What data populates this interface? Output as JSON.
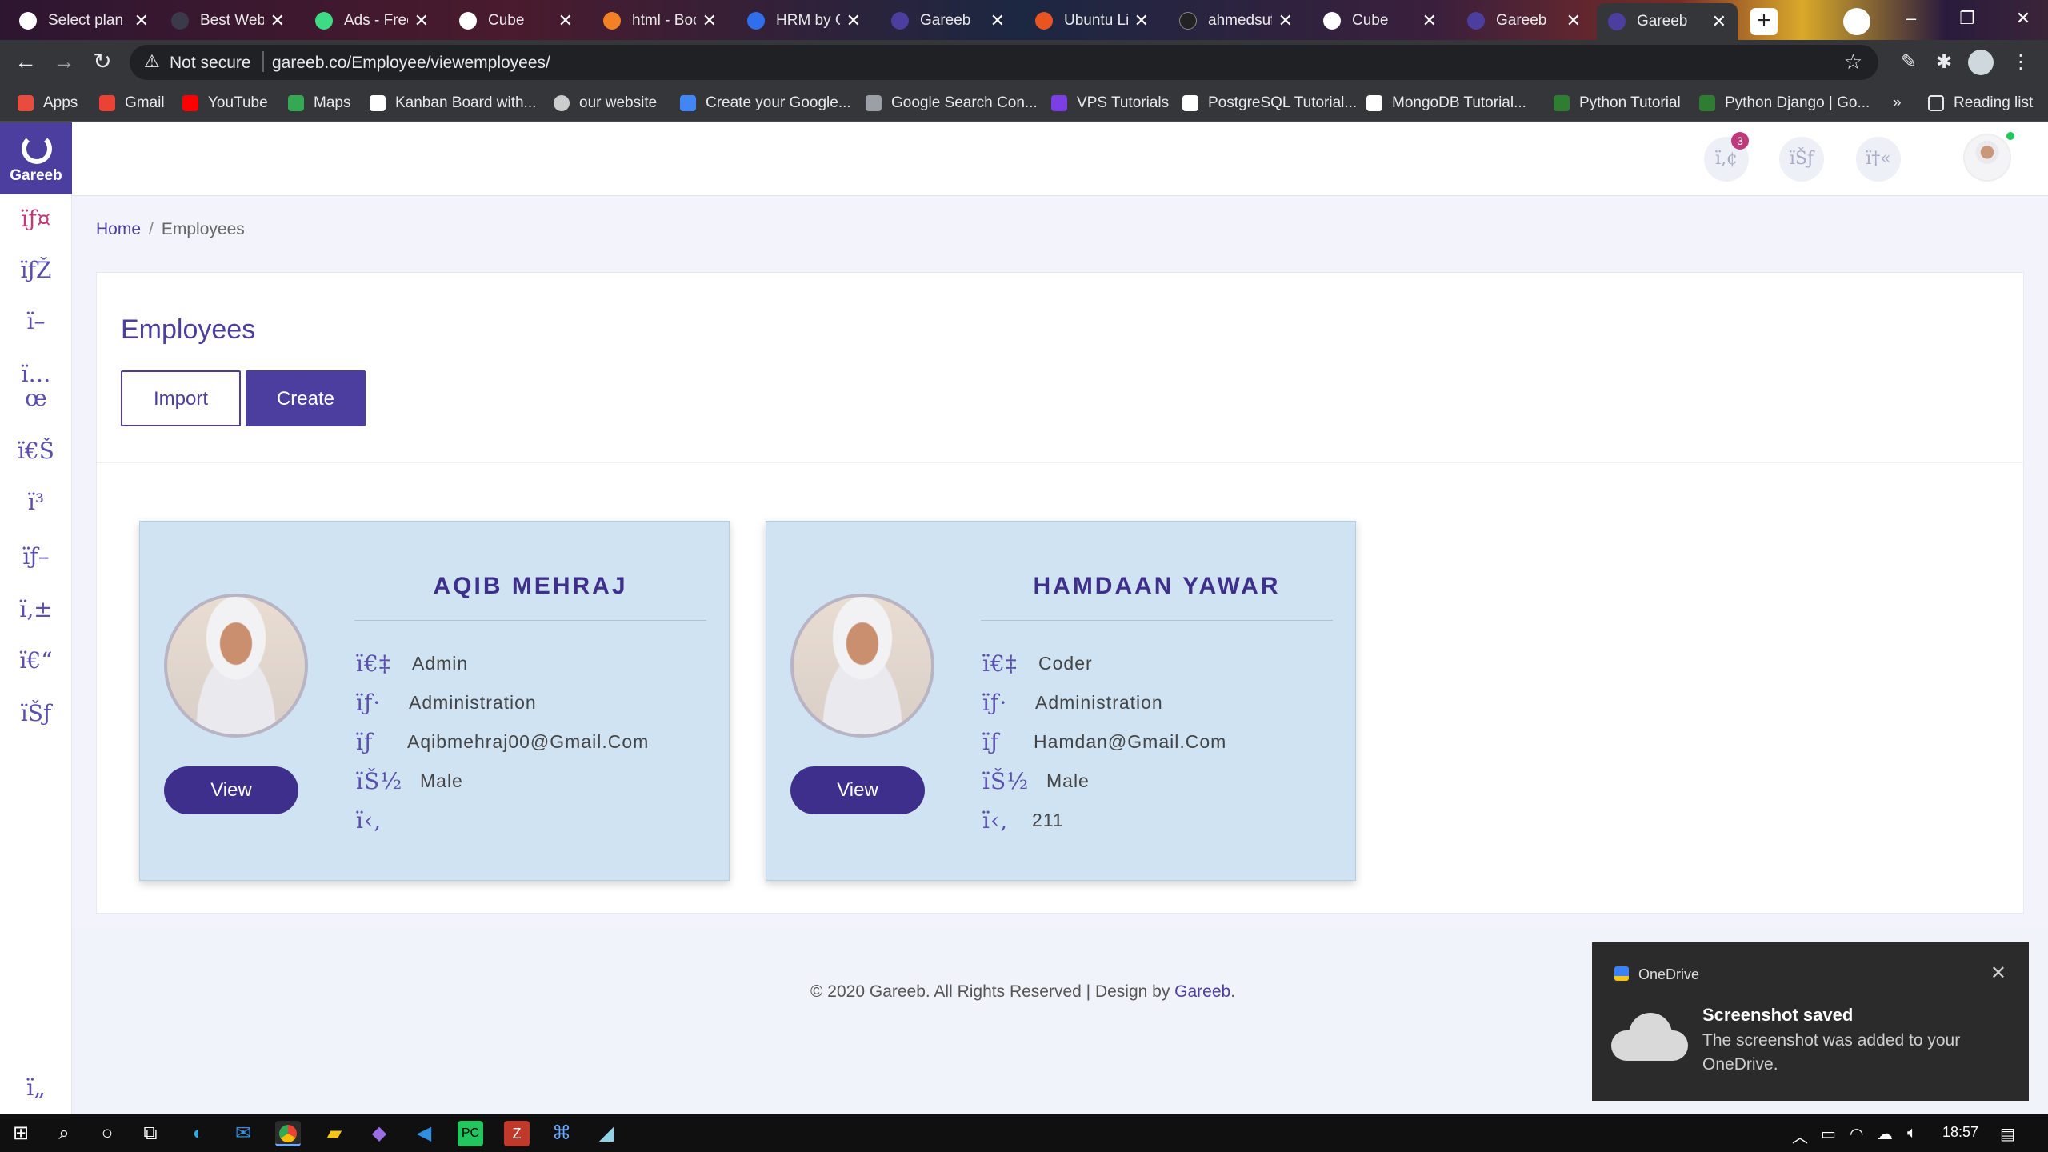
{
  "browser": {
    "tabs": [
      {
        "title": "Select plan",
        "favicon_color": "#ffffff"
      },
      {
        "title": "Best Websites",
        "favicon_color": "#3a3a4a"
      },
      {
        "title": "Ads - Free",
        "favicon_color": "#3ddc84"
      },
      {
        "title": "Cube",
        "favicon_color": "#ffffff"
      },
      {
        "title": "html - Boo",
        "favicon_color": "#f48024"
      },
      {
        "title": "HRM by G",
        "favicon_color": "#2f6fed"
      },
      {
        "title": "Gareeb",
        "favicon_color": "#4b3e9f"
      },
      {
        "title": "Ubuntu Lin",
        "favicon_color": "#e95420"
      },
      {
        "title": "ahmedsuf",
        "favicon_color": "#222222"
      },
      {
        "title": "Cube",
        "favicon_color": "#ffffff"
      },
      {
        "title": "Gareeb",
        "favicon_color": "#4b3e9f"
      },
      {
        "title": "Gareeb",
        "favicon_color": "#4b3e9f",
        "active": true
      }
    ],
    "new_tab_label": "+",
    "address": {
      "warning": "Not secure",
      "url": "gareeb.co/Employee/viewemployees/"
    },
    "bookmarks": [
      {
        "label": "Apps",
        "color": "#e74c3c"
      },
      {
        "label": "Gmail",
        "color": "#ea4335"
      },
      {
        "label": "YouTube",
        "color": "#ff0000"
      },
      {
        "label": "Maps",
        "color": "#34a853"
      },
      {
        "label": "Kanban Board with...",
        "color": "#ffffff"
      },
      {
        "label": "our website",
        "color": "#cccccc"
      },
      {
        "label": "Create your Google...",
        "color": "#4285f4"
      },
      {
        "label": "Google Search Con...",
        "color": "#9aa0a6"
      },
      {
        "label": "VPS Tutorials",
        "color": "#7b3fe4"
      },
      {
        "label": "PostgreSQL Tutorial...",
        "color": "#ffffff"
      },
      {
        "label": "MongoDB Tutorial...",
        "color": "#ffffff"
      },
      {
        "label": "Python Tutorial",
        "color": "#2e7d32"
      },
      {
        "label": "Python Django | Go...",
        "color": "#2e7d32"
      }
    ],
    "more_bookmarks": "»",
    "reading_list": "Reading list"
  },
  "app": {
    "logo_text": "Gareeb",
    "sidebar_icons": [
      "ïƒ¤",
      "ïƒŽ",
      "ï–",
      "ï…œ",
      "ï€Š",
      "ï³",
      "ïƒ–",
      "ï‚±",
      "ï€“",
      "ïŠƒ"
    ],
    "sidebar_bottom_icon": "ï„",
    "header_icons": [
      "ï‚¢",
      "ïŠƒ",
      "ï†«"
    ],
    "notification_count": "3",
    "breadcrumb": {
      "home": "Home",
      "separator": "/",
      "current": "Employees"
    },
    "page_title": "Employees",
    "buttons": {
      "import": "Import",
      "create": "Create"
    },
    "employees": [
      {
        "name": "AQIB MEHRAJ",
        "view_label": "View",
        "rows": [
          {
            "icon": "ï€‡",
            "value": "Admin"
          },
          {
            "icon": "ïƒ·",
            "value": "Administration"
          },
          {
            "icon": "ïƒ",
            "value": "Aqibmehraj00@Gmail.Com"
          },
          {
            "icon": "ïŠ½",
            "value": "Male"
          },
          {
            "icon": "ï‹‚",
            "value": ""
          }
        ]
      },
      {
        "name": "HAMDAAN YAWAR",
        "view_label": "View",
        "rows": [
          {
            "icon": "ï€‡",
            "value": "Coder"
          },
          {
            "icon": "ïƒ·",
            "value": "Administration"
          },
          {
            "icon": "ïƒ",
            "value": "Hamdan@Gmail.Com"
          },
          {
            "icon": "ïŠ½",
            "value": "Male"
          },
          {
            "icon": "ï‹‚",
            "value": "211"
          }
        ]
      }
    ],
    "footer": {
      "text": "© 2020 Gareeb. All Rights Reserved | Design by ",
      "brand": "Gareeb",
      "end": "."
    }
  },
  "toast": {
    "app": "OneDrive",
    "title": "Screenshot saved",
    "body": "The screenshot was added to your OneDrive.",
    "close": "✕"
  },
  "taskbar": {
    "time": "18:57"
  },
  "colors": {
    "primary": "#4b3e9f",
    "card_bg": "#cfe3f3",
    "view_button": "#3e2f8c",
    "active_menu": "#c03a7b"
  }
}
